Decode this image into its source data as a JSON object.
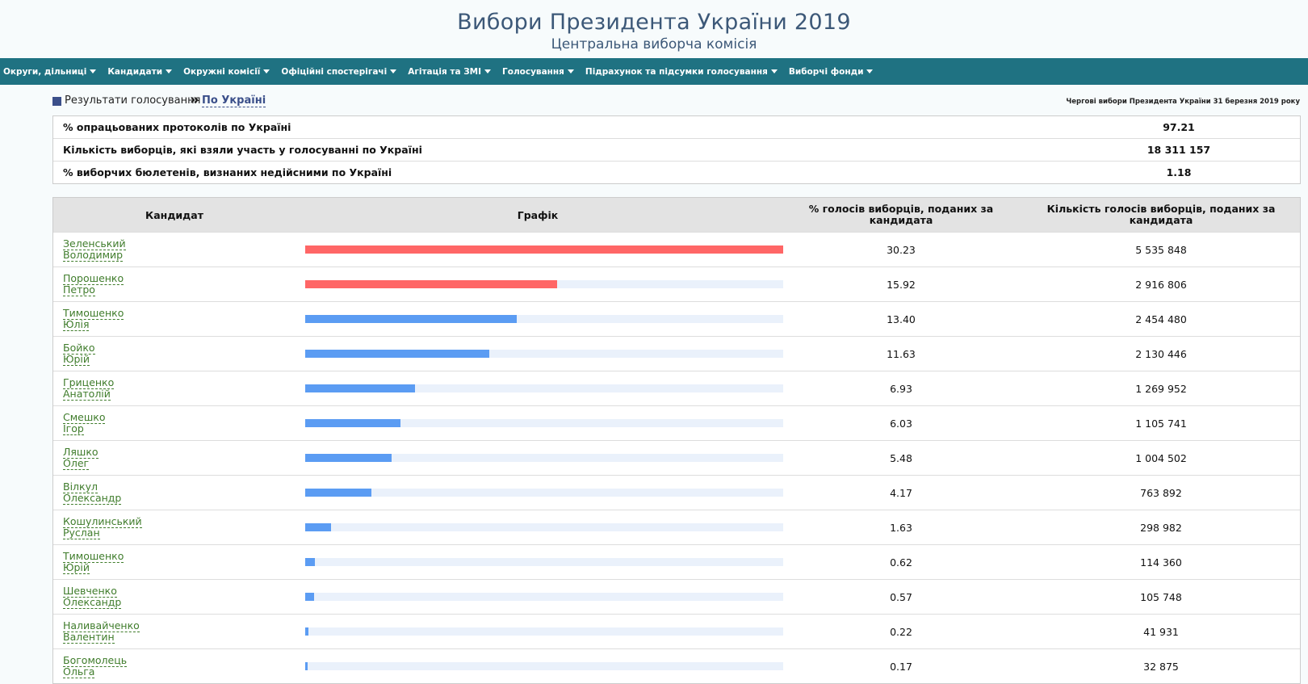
{
  "header": {
    "title": "Вибори Президента України 2019",
    "subtitle": "Центральна виборча комісія"
  },
  "nav": {
    "items": [
      "Округи, дільниці",
      "Кандидати",
      "Окружні комісії",
      "Офіційні спостерігачі",
      "Агітація та ЗМІ",
      "Голосування",
      "Підрахунок та підсумки голосування",
      "Виборчі фонди"
    ]
  },
  "breadcrumb": {
    "root": "Результати голосування",
    "separator": "»",
    "current": "По Україні",
    "election_label": "Чергові вибори Президента України 31 березня 2019 року"
  },
  "summary": [
    {
      "label": "% опрацьованих протоколів по Україні",
      "value": "97.21"
    },
    {
      "label": "Кількість виборців, які взяли участь у голосуванні по Україні",
      "value": "18 311 157"
    },
    {
      "label": "% виборчих бюлетенів, визнаних недійсними по Україні",
      "value": "1.18"
    }
  ],
  "table": {
    "headers": {
      "candidate": "Кандидат",
      "chart": "Графік",
      "percent": "% голосів виборців, поданих за кандидата",
      "count": "Кількість голосів виборців, поданих за кандидата"
    },
    "colors": {
      "leader": "#ff6666",
      "other": "#5b9cf3",
      "track": "#eaf1fb"
    },
    "rows": [
      {
        "surname": "Зеленський",
        "name": "Володимир",
        "percent": "30.23",
        "count": "5 535 848",
        "leader": true
      },
      {
        "surname": "Порошенко",
        "name": "Петро",
        "percent": "15.92",
        "count": "2 916 806",
        "leader": true
      },
      {
        "surname": "Тимошенко",
        "name": "Юлія",
        "percent": "13.40",
        "count": "2 454 480",
        "leader": false
      },
      {
        "surname": "Бойко",
        "name": "Юрій",
        "percent": "11.63",
        "count": "2 130 446",
        "leader": false
      },
      {
        "surname": "Гриценко",
        "name": "Анатолій",
        "percent": "6.93",
        "count": "1 269 952",
        "leader": false
      },
      {
        "surname": "Смешко",
        "name": "Ігор",
        "percent": "6.03",
        "count": "1 105 741",
        "leader": false
      },
      {
        "surname": "Ляшко",
        "name": "Олег",
        "percent": "5.48",
        "count": "1 004 502",
        "leader": false
      },
      {
        "surname": "Вілкул",
        "name": "Олександр",
        "percent": "4.17",
        "count": "763 892",
        "leader": false
      },
      {
        "surname": "Кошулинський",
        "name": "Руслан",
        "percent": "1.63",
        "count": "298 982",
        "leader": false
      },
      {
        "surname": "Тимошенко",
        "name": "Юрій",
        "percent": "0.62",
        "count": "114 360",
        "leader": false
      },
      {
        "surname": "Шевченко",
        "name": "Олександр",
        "percent": "0.57",
        "count": "105 748",
        "leader": false
      },
      {
        "surname": "Наливайченко",
        "name": "Валентин",
        "percent": "0.22",
        "count": "41 931",
        "leader": false
      },
      {
        "surname": "Богомолець",
        "name": "Ольга",
        "percent": "0.17",
        "count": "32 875",
        "leader": false
      }
    ]
  }
}
